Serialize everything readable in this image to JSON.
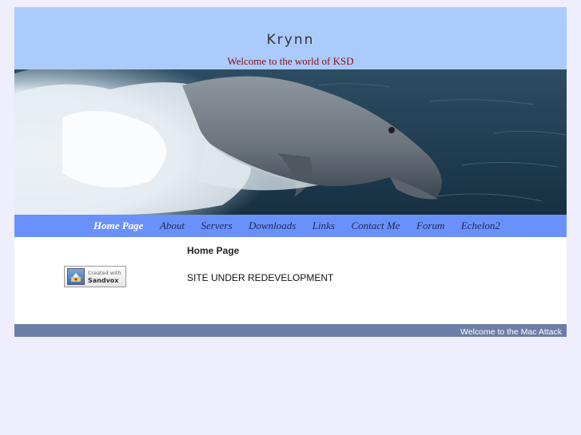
{
  "header": {
    "title": "Krynn",
    "tagline": "Welcome to the world of KSD"
  },
  "banner": {
    "image": "dolphin-photo"
  },
  "nav": {
    "items": [
      {
        "label": "Home Page",
        "current": true
      },
      {
        "label": "About"
      },
      {
        "label": "Servers"
      },
      {
        "label": "Downloads"
      },
      {
        "label": "Links"
      },
      {
        "label": "Contact Me"
      },
      {
        "label": "Forum"
      },
      {
        "label": "Echelon2"
      }
    ]
  },
  "sidebar": {
    "badge_line1": "Created with",
    "badge_line2": "Sandvox"
  },
  "main": {
    "heading": "Home Page",
    "text": "SITE UNDER REDEVELOPMENT"
  },
  "footer": {
    "text": "Welcome to the Mac Attack"
  },
  "colors": {
    "page_bg": "#eeeefc",
    "header_bg": "#abcbfd",
    "nav_bg": "#6a91fb",
    "footer_bg": "#6b7fa6",
    "tagline": "#8b1010"
  }
}
